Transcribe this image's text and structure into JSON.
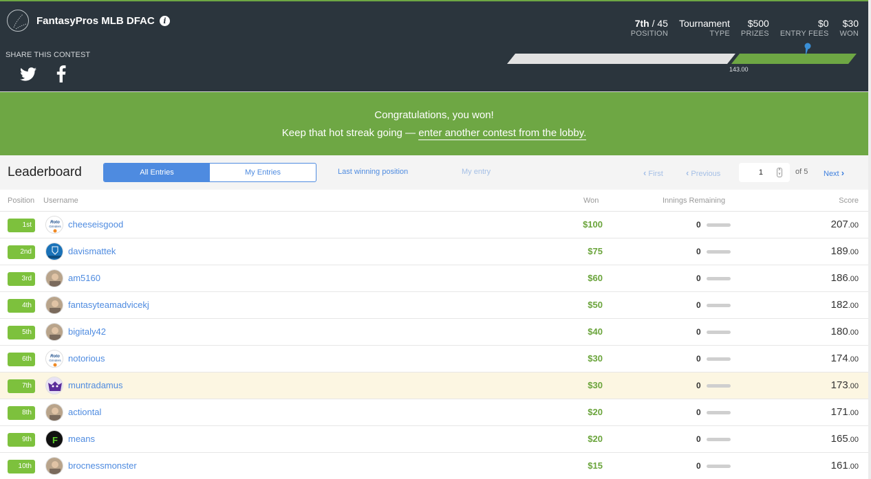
{
  "header": {
    "contest_title": "FantasyPros MLB DFAC",
    "share_label": "SHARE THIS CONTEST",
    "stats": [
      {
        "value_bold": "7th",
        "value_rest": " / 45",
        "label": "POSITION"
      },
      {
        "value_bold": "",
        "value_rest": "Tournament",
        "label": "TYPE"
      },
      {
        "value_bold": "",
        "value_rest": "$500",
        "label": "PRIZES"
      },
      {
        "value_bold": "",
        "value_rest": "$0",
        "label": "ENTRY FEES"
      },
      {
        "value_bold": "",
        "value_rest": "$30",
        "label": "WON"
      }
    ],
    "progress": {
      "cashline_label": "143.00",
      "cashline_fraction": 0.66,
      "my_marker_fraction": 0.86,
      "colors": {
        "below": "#e2e2e2",
        "above": "#6ea744",
        "marker": "#3a8fd6"
      }
    }
  },
  "banner": {
    "line1": "Congratulations, you won!",
    "line2_prefix": "Keep that hot streak going — ",
    "line2_link": "enter another contest from the lobby."
  },
  "toolbar": {
    "title": "Leaderboard",
    "tabs": [
      {
        "label": "All Entries",
        "active": true
      },
      {
        "label": "My Entries",
        "active": false
      }
    ],
    "last_winning_position": "Last winning position",
    "my_entry": "My entry",
    "pager": {
      "first": "First",
      "previous": "Previous",
      "current_page": "1",
      "of_label": "of 5",
      "next": "Next"
    }
  },
  "table": {
    "columns": {
      "position": "Position",
      "username": "Username",
      "won": "Won",
      "innings": "Innings Remaining",
      "score": "Score"
    },
    "rows": [
      {
        "rank": "1st",
        "username": "cheeseisgood",
        "avatar": "rotogrinders-logo",
        "won": "$100",
        "innings": "0",
        "score_int": "207",
        "score_dec": ".00",
        "me": false
      },
      {
        "rank": "2nd",
        "username": "davismattek",
        "avatar": "blue-team-logo",
        "won": "$75",
        "innings": "0",
        "score_int": "189",
        "score_dec": ".00",
        "me": false
      },
      {
        "rank": "3rd",
        "username": "am5160",
        "avatar": "user-photo",
        "won": "$60",
        "innings": "0",
        "score_int": "186",
        "score_dec": ".00",
        "me": false
      },
      {
        "rank": "4th",
        "username": "fantasyteamadvicekj",
        "avatar": "user-photo",
        "won": "$50",
        "innings": "0",
        "score_int": "182",
        "score_dec": ".00",
        "me": false
      },
      {
        "rank": "5th",
        "username": "bigitaly42",
        "avatar": "user-photo",
        "won": "$40",
        "innings": "0",
        "score_int": "180",
        "score_dec": ".00",
        "me": false
      },
      {
        "rank": "6th",
        "username": "notorious",
        "avatar": "rotogrinders-logo",
        "won": "$30",
        "innings": "0",
        "score_int": "174",
        "score_dec": ".00",
        "me": false
      },
      {
        "rank": "7th",
        "username": "muntradamus",
        "avatar": "purple-monster-logo",
        "won": "$30",
        "innings": "0",
        "score_int": "173",
        "score_dec": ".00",
        "me": true
      },
      {
        "rank": "8th",
        "username": "actiontal",
        "avatar": "user-photo",
        "won": "$20",
        "innings": "0",
        "score_int": "171",
        "score_dec": ".00",
        "me": false
      },
      {
        "rank": "9th",
        "username": "means",
        "avatar": "green-f-logo",
        "won": "$20",
        "innings": "0",
        "score_int": "165",
        "score_dec": ".00",
        "me": false
      },
      {
        "rank": "10th",
        "username": "brocnessmonster",
        "avatar": "user-photo",
        "won": "$15",
        "innings": "0",
        "score_int": "161",
        "score_dec": ".00",
        "me": false
      }
    ]
  }
}
